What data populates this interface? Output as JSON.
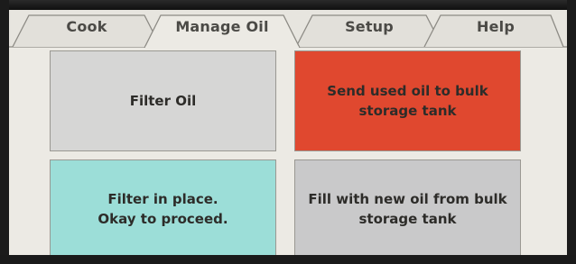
{
  "tabs": [
    {
      "label": "Cook",
      "active": false
    },
    {
      "label": "Manage Oil",
      "active": true
    },
    {
      "label": "Setup",
      "active": false
    },
    {
      "label": "Help",
      "active": false
    }
  ],
  "buttons": {
    "filter_oil": "Filter Oil",
    "send_bulk": "Send used oil to bulk\nstorage tank",
    "filter_in_place": "Filter in place.\nOkay to proceed.",
    "fill_new": "Fill with new oil from bulk\nstorage tank"
  },
  "colors": {
    "filter_oil": "#d6d6d5",
    "send_bulk": "#e0482f",
    "filter_in_place": "#9cded8",
    "fill_new": "#c9c9ca",
    "screen_bg": "#eceae4"
  }
}
